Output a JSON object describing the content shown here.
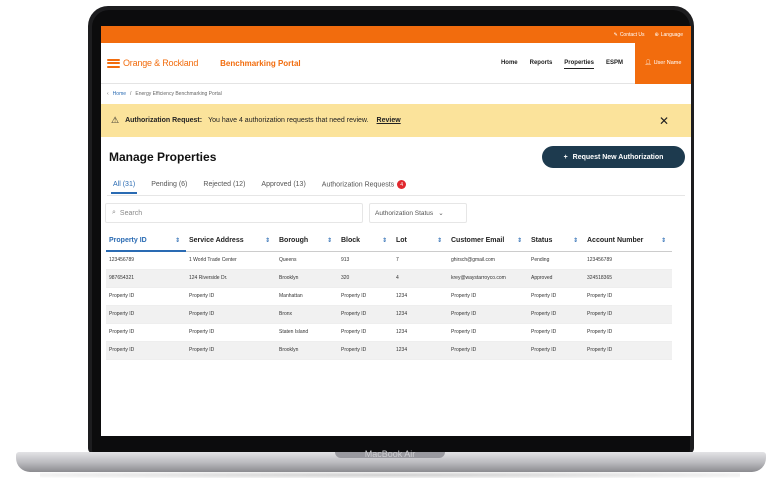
{
  "device": {
    "label": "MacBook Air"
  },
  "utility": {
    "contact": "Contact Us",
    "language": "Language"
  },
  "header": {
    "logo_text": "Orange & Rockland",
    "portal_title": "Benchmarking Portal",
    "nav": [
      "Home",
      "Reports",
      "Properties",
      "ESPM"
    ],
    "active_nav": "Properties",
    "user_label": "User Name"
  },
  "breadcrumb": {
    "home": "Home",
    "separator": "/",
    "current": "Energy Efficiency Benchmarking Portal"
  },
  "alert": {
    "title": "Authorization Request:",
    "message": "You have 4 authorization requests that need review.",
    "action": "Review",
    "close": "✕"
  },
  "page": {
    "title": "Manage Properties",
    "request_button": "Request New Authorization"
  },
  "tabs": [
    {
      "label": "All (31)",
      "active": true
    },
    {
      "label": "Pending (6)"
    },
    {
      "label": "Rejected (12)"
    },
    {
      "label": "Approved (13)"
    },
    {
      "label": "Authorization Requests",
      "badge": "4"
    }
  ],
  "filters": {
    "search_placeholder": "Search",
    "status_select": "Authorization Status"
  },
  "table": {
    "columns": [
      "Property ID",
      "Service Address",
      "Borough",
      "Block",
      "Lot",
      "Customer Email",
      "Status",
      "Account Number"
    ],
    "rows": [
      [
        "123456789",
        "1 World Trade Center",
        "Queens",
        "913",
        "7",
        "ghirsch@gmail.com",
        "Pending",
        "123456789"
      ],
      [
        "987654321",
        "124 Riverside Dr.",
        "Brooklyn",
        "320",
        "4",
        "krey@waystarroyco.com",
        "Approved",
        "324518365"
      ],
      [
        "Property ID",
        "Property ID",
        "Manhattan",
        "Property ID",
        "1234",
        "Property ID",
        "Property ID",
        "Property ID"
      ],
      [
        "Property ID",
        "Property ID",
        "Bronx",
        "Property ID",
        "1234",
        "Property ID",
        "Property ID",
        "Property ID"
      ],
      [
        "Property ID",
        "Property ID",
        "Staten Island",
        "Property ID",
        "1234",
        "Property ID",
        "Property ID",
        "Property ID"
      ],
      [
        "Property ID",
        "Property ID",
        "Brooklyn",
        "Property ID",
        "1234",
        "Property ID",
        "Property ID",
        "Property ID"
      ]
    ]
  },
  "colors": {
    "brand_orange": "#f26c0d",
    "navy": "#1d3a4e",
    "link_blue": "#2a6bb3",
    "alert_yellow": "#fbe39b",
    "badge_red": "#e0282e"
  }
}
